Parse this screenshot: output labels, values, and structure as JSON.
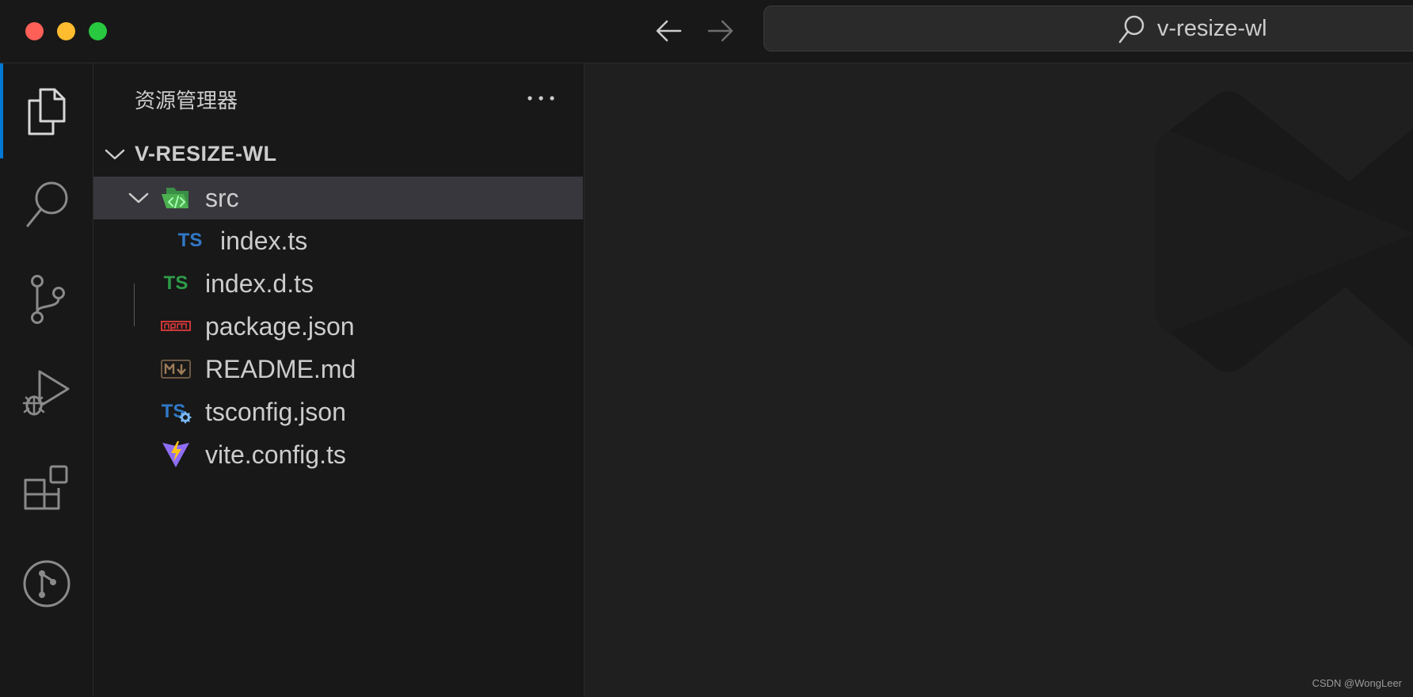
{
  "search": {
    "text": "v-resize-wl"
  },
  "activity_bar": {
    "items": [
      {
        "name": "explorer",
        "icon": "files-icon",
        "active": true
      },
      {
        "name": "search",
        "icon": "search-icon"
      },
      {
        "name": "source-control",
        "icon": "source-control-icon"
      },
      {
        "name": "run-and-debug",
        "icon": "run-debug-icon"
      },
      {
        "name": "extensions",
        "icon": "extensions-icon"
      },
      {
        "name": "remote",
        "icon": "remote-explorer-icon"
      }
    ]
  },
  "sidebar": {
    "title": "资源管理器",
    "folder": "V-RESIZE-WL",
    "tree": [
      {
        "label": "src",
        "icon": "folder-src-icon",
        "expanded": true,
        "selected": true
      },
      {
        "label": "index.ts",
        "icon": "typescript-icon"
      },
      {
        "label": "index.d.ts",
        "icon": "typescript-def-icon"
      },
      {
        "label": "package.json",
        "icon": "npm-icon"
      },
      {
        "label": "README.md",
        "icon": "markdown-icon"
      },
      {
        "label": "tsconfig.json",
        "icon": "tsconfig-icon"
      },
      {
        "label": "vite.config.ts",
        "icon": "vite-icon"
      }
    ]
  },
  "colors": {
    "accent": "#0078d4",
    "ts_blue": "#3178c6",
    "ts_def_green": "#2e9b49",
    "npm_red": "#cb3837",
    "selection": "#37373d"
  },
  "watermark": {
    "credit": "CSDN @WongLeer"
  }
}
